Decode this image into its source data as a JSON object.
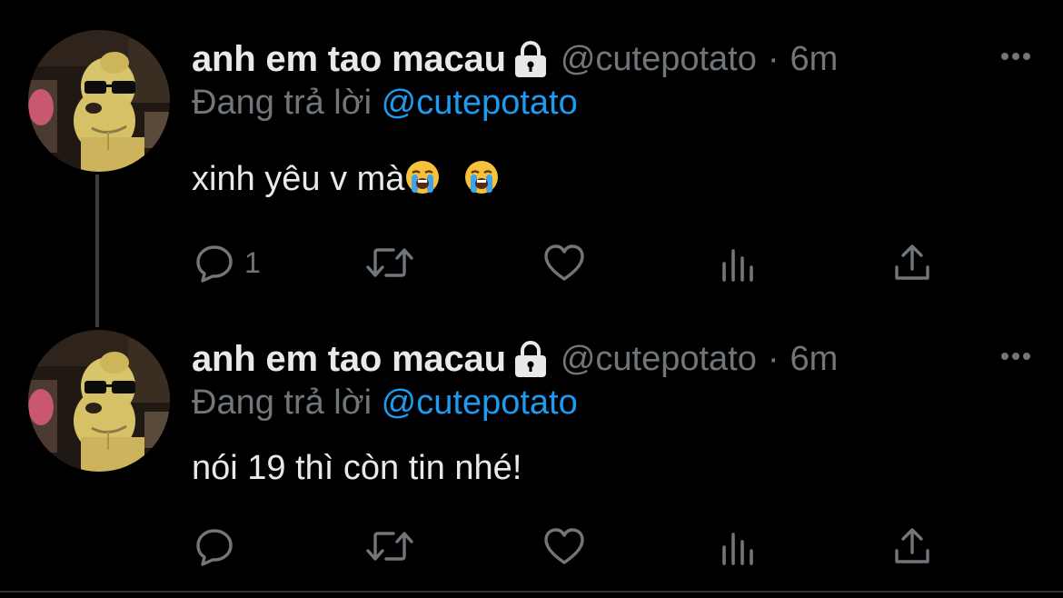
{
  "colors": {
    "background": "#000000",
    "text_primary": "#e7e9ea",
    "text_secondary": "#71767b",
    "accent": "#1d9bf0"
  },
  "tweets": [
    {
      "display_name": "anh em tao macau",
      "protected_icon": "lock-icon",
      "handle": "@cutepotato",
      "separator": "·",
      "timestamp": "6m",
      "reply_prefix": "Đang trả lời",
      "reply_handle": "@cutepotato",
      "text": "xinh yêu v mà",
      "emojis": [
        "loudly-crying-face",
        "loudly-crying-face"
      ],
      "reply_count": "1"
    },
    {
      "display_name": "anh em tao macau",
      "protected_icon": "lock-icon",
      "handle": "@cutepotato",
      "separator": "·",
      "timestamp": "6m",
      "reply_prefix": "Đang trả lời",
      "reply_handle": "@cutepotato",
      "text": "nói 19 thì còn tin nhé!",
      "emojis": [],
      "reply_count": ""
    }
  ],
  "action_icons": [
    "reply-icon",
    "retweet-icon",
    "like-icon",
    "views-icon",
    "share-icon"
  ],
  "more_icon": "more-options-icon"
}
